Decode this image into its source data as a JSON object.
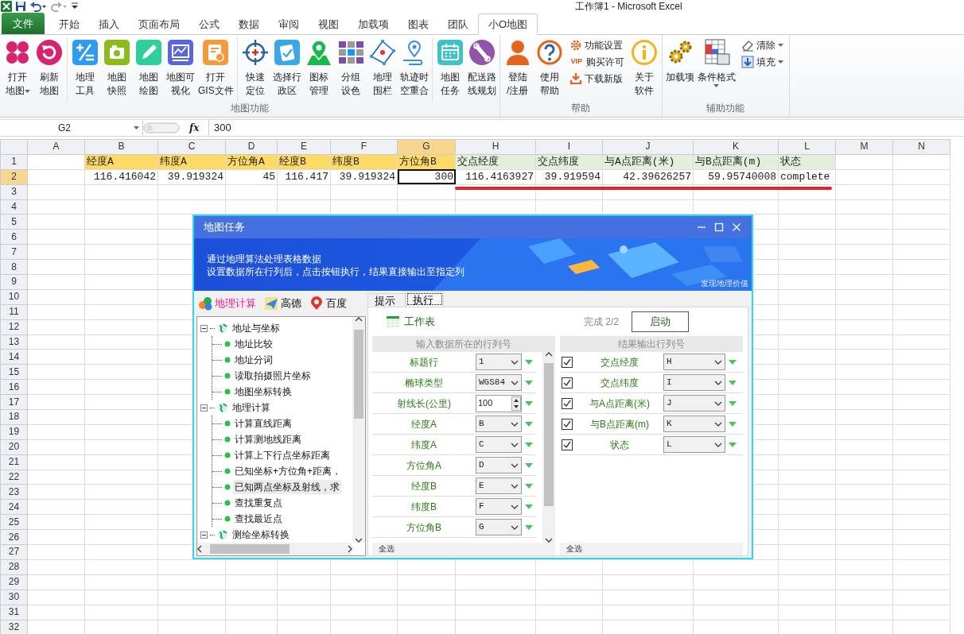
{
  "title_bar": {
    "title": "工作簿1  -  Microsoft Excel"
  },
  "ribbon_tabs": [
    {
      "label": "文件",
      "kind": "file",
      "selected": false
    },
    {
      "label": "开始",
      "kind": "tab",
      "selected": false
    },
    {
      "label": "插入",
      "kind": "tab",
      "selected": false
    },
    {
      "label": "页面布局",
      "kind": "tab",
      "selected": false
    },
    {
      "label": "公式",
      "kind": "tab",
      "selected": false
    },
    {
      "label": "数据",
      "kind": "tab",
      "selected": false
    },
    {
      "label": "审阅",
      "kind": "tab",
      "selected": false
    },
    {
      "label": "视图",
      "kind": "tab",
      "selected": false
    },
    {
      "label": "加载项",
      "kind": "tab",
      "selected": false
    },
    {
      "label": "图表",
      "kind": "tab",
      "selected": false
    },
    {
      "label": "团队",
      "kind": "tab",
      "selected": false
    },
    {
      "label": "小O地图",
      "kind": "tab",
      "selected": true
    }
  ],
  "ribbon_groups": [
    {
      "label": "地图功能",
      "sections": [
        [
          {
            "kind": "large",
            "lines": [
              "打开",
              "地图"
            ],
            "dropdown": true
          },
          {
            "kind": "large",
            "lines": [
              "刷新",
              "地图"
            ],
            "dropdown": false
          }
        ],
        [
          {
            "kind": "large",
            "lines": [
              "地理",
              "工具"
            ],
            "dropdown": false
          },
          {
            "kind": "large",
            "lines": [
              "地图",
              "快照"
            ],
            "dropdown": false
          },
          {
            "kind": "large",
            "lines": [
              "地图",
              "绘图"
            ],
            "dropdown": false
          },
          {
            "kind": "large",
            "lines": [
              "地图可",
              "视化"
            ],
            "dropdown": false
          },
          {
            "kind": "large",
            "lines": [
              "打开",
              "GIS文件"
            ],
            "dropdown": false
          }
        ],
        [
          {
            "kind": "large",
            "lines": [
              "快速",
              "定位"
            ],
            "dropdown": false
          },
          {
            "kind": "large",
            "lines": [
              "选择行",
              "政区"
            ],
            "dropdown": false
          },
          {
            "kind": "large",
            "lines": [
              "图标",
              "管理"
            ],
            "dropdown": false
          },
          {
            "kind": "large",
            "lines": [
              "分组",
              "设色"
            ],
            "dropdown": false
          },
          {
            "kind": "large",
            "lines": [
              "地理",
              "围栏"
            ],
            "dropdown": false
          },
          {
            "kind": "large",
            "lines": [
              "轨迹时",
              "空重合"
            ],
            "dropdown": false
          }
        ],
        [
          {
            "kind": "large",
            "lines": [
              "地图",
              "任务"
            ],
            "dropdown": false
          },
          {
            "kind": "large",
            "lines": [
              "配送路",
              "线规划"
            ],
            "dropdown": false
          }
        ]
      ]
    },
    {
      "label": "帮助",
      "sections": [
        [
          {
            "kind": "large",
            "lines": [
              "登陆",
              "/注册"
            ],
            "dropdown": false
          },
          {
            "kind": "large",
            "lines": [
              "使用",
              "帮助"
            ],
            "dropdown": false
          },
          {
            "kind": "stack",
            "items": [
              {
                "label": "功能设置",
                "dropdown": false
              },
              {
                "label": "购买许可",
                "icon_text": "VIP",
                "dropdown": false
              },
              {
                "label": "下载新版",
                "dropdown": false
              }
            ]
          },
          {
            "kind": "large",
            "lines": [
              "关于",
              "软件"
            ],
            "dropdown": false
          }
        ]
      ]
    },
    {
      "label": "辅助功能",
      "sections": [
        [
          {
            "kind": "large",
            "lines": [
              "加载项"
            ],
            "dropdown": false
          },
          {
            "kind": "large",
            "lines": [
              "条件格式"
            ],
            "dropdown": true
          },
          {
            "kind": "stack",
            "items": [
              {
                "label": "清除",
                "dropdown": true
              },
              {
                "label": "填充",
                "dropdown": true
              }
            ]
          }
        ]
      ]
    }
  ],
  "formula_bar": {
    "name_box": "G2",
    "function_label": "fx",
    "value": "300"
  },
  "sheet": {
    "columns": [
      "A",
      "B",
      "C",
      "D",
      "E",
      "F",
      "G",
      "H",
      "I",
      "J",
      "K",
      "L",
      "M",
      "N"
    ],
    "rows": [
      {
        "number": "1",
        "cells": [
          {
            "text": "经度A",
            "kind": "text",
            "color": "#ffd966",
            "selected": false
          },
          {
            "text": "纬度A",
            "kind": "text",
            "color": "#ffd966",
            "selected": false
          },
          {
            "text": "方位角A",
            "kind": "text",
            "color": "#ffd966",
            "selected": false
          },
          {
            "text": "经度B",
            "kind": "text",
            "color": "#ffd966",
            "selected": false
          },
          {
            "text": "纬度B",
            "kind": "text",
            "color": "#ffd966",
            "selected": false
          },
          {
            "text": "方位角B",
            "kind": "text",
            "color": "#ffd966",
            "selected": false
          },
          {
            "text": "交点经度",
            "kind": "text",
            "color": "#e2efda",
            "selected": false
          },
          {
            "text": "交点纬度",
            "kind": "text",
            "color": "#e2efda",
            "selected": false
          },
          {
            "text": "与A点距离(米)",
            "kind": "text",
            "color": "#e2efda",
            "selected": false
          },
          {
            "text": "与B点距离(m)",
            "kind": "text",
            "color": "#e2efda",
            "selected": false
          },
          {
            "text": "状态",
            "kind": "text",
            "color": "#e2efda",
            "selected": false
          }
        ]
      },
      {
        "number": "2",
        "cells": [
          {
            "text": "116.416042",
            "kind": "number",
            "selected": false
          },
          {
            "text": "39.919324",
            "kind": "number",
            "selected": false
          },
          {
            "text": "45",
            "kind": "number",
            "selected": false
          },
          {
            "text": "116.417",
            "kind": "number",
            "selected": false
          },
          {
            "text": "39.919324",
            "kind": "number",
            "selected": false
          },
          {
            "text": "300",
            "kind": "number",
            "selected": true
          },
          {
            "text": "116.4163927",
            "kind": "number",
            "selected": false
          },
          {
            "text": "39.919594",
            "kind": "number",
            "selected": false
          },
          {
            "text": "42.39626257",
            "kind": "number",
            "selected": false
          },
          {
            "text": "59.95740008",
            "kind": "number",
            "selected": false
          },
          {
            "text": "complete",
            "kind": "text",
            "selected": false
          }
        ]
      },
      {
        "number": "3"
      },
      {
        "number": "4"
      },
      {
        "number": "5"
      },
      {
        "number": "6"
      },
      {
        "number": "7"
      },
      {
        "number": "8"
      },
      {
        "number": "9"
      },
      {
        "number": "10"
      },
      {
        "number": "11"
      },
      {
        "number": "12"
      },
      {
        "number": "13"
      },
      {
        "number": "14"
      },
      {
        "number": "15"
      },
      {
        "number": "16"
      },
      {
        "number": "17"
      },
      {
        "number": "18"
      },
      {
        "number": "19"
      },
      {
        "number": "20"
      },
      {
        "number": "21"
      },
      {
        "number": "22"
      },
      {
        "number": "23"
      },
      {
        "number": "24"
      },
      {
        "number": "25"
      },
      {
        "number": "26"
      },
      {
        "number": "27"
      },
      {
        "number": "28"
      },
      {
        "number": "29"
      },
      {
        "number": "30"
      },
      {
        "number": "31"
      },
      {
        "number": "32"
      }
    ]
  },
  "dialog": {
    "title": "地图任务",
    "banner": {
      "lines": [
        "通过地理算法处理表格数据",
        "设置数据所在行列后，点击按钮执行，结果直接输出至指定列"
      ],
      "slogan": "发现地理价值"
    },
    "sources": [
      {
        "label": "地理计算",
        "selected": true
      },
      {
        "label": "高德",
        "selected": false
      },
      {
        "label": "百度",
        "selected": false
      }
    ],
    "tree": [
      {
        "label": "地址与坐标",
        "expanded": true,
        "selected": false,
        "children": [
          {
            "label": "地址比较",
            "selected": false
          },
          {
            "label": "地址分词",
            "selected": false
          },
          {
            "label": "读取拍摄照片坐标",
            "selected": false
          },
          {
            "label": "地图坐标转换",
            "selected": false
          }
        ]
      },
      {
        "label": "地理计算",
        "expanded": true,
        "selected": false,
        "children": [
          {
            "label": "计算直线距离",
            "selected": false
          },
          {
            "label": "计算测地线距离",
            "selected": false
          },
          {
            "label": "计算上下行点坐标距离",
            "selected": false
          },
          {
            "label": "已知坐标+方位角+距离，",
            "selected": false
          },
          {
            "label": "已知两点坐标及射线，求",
            "selected": true
          },
          {
            "label": "查找重复点",
            "selected": false
          },
          {
            "label": "查找最近点",
            "selected": false
          }
        ]
      },
      {
        "label": "测绘坐标转换",
        "expanded": true,
        "selected": false
      }
    ],
    "tabs": [
      {
        "label": "提示",
        "selected": false
      },
      {
        "label": "执行",
        "selected": true
      }
    ],
    "sheet_label": "工作表",
    "progress": "完成 2/2",
    "start_button": "启动",
    "inputs": {
      "header": "输入数据所在的行列号",
      "select_all": "全选",
      "rows": [
        {
          "label": "标题行",
          "kind": "select",
          "value": "1"
        },
        {
          "label": "椭球类型",
          "kind": "select",
          "value": "WGS84"
        },
        {
          "label": "射线长(公里)",
          "kind": "spin",
          "value": "100"
        },
        {
          "label": "经度A",
          "kind": "select",
          "value": "B"
        },
        {
          "label": "纬度A",
          "kind": "select",
          "value": "C"
        },
        {
          "label": "方位角A",
          "kind": "select",
          "value": "D"
        },
        {
          "label": "经度B",
          "kind": "select",
          "value": "E"
        },
        {
          "label": "纬度B",
          "kind": "select",
          "value": "F"
        },
        {
          "label": "方位角B",
          "kind": "select",
          "value": "G"
        }
      ]
    },
    "outputs": {
      "header": "结果输出行列号",
      "select_all": "全选",
      "rows": [
        {
          "label": "交点经度",
          "checked": true,
          "value": "H"
        },
        {
          "label": "交点纬度",
          "checked": true,
          "value": "I"
        },
        {
          "label": "与A点距离(米)",
          "checked": true,
          "value": "J"
        },
        {
          "label": "与B点距离(m)",
          "checked": true,
          "value": "K"
        },
        {
          "label": "状态",
          "checked": true,
          "value": "L"
        }
      ]
    }
  }
}
